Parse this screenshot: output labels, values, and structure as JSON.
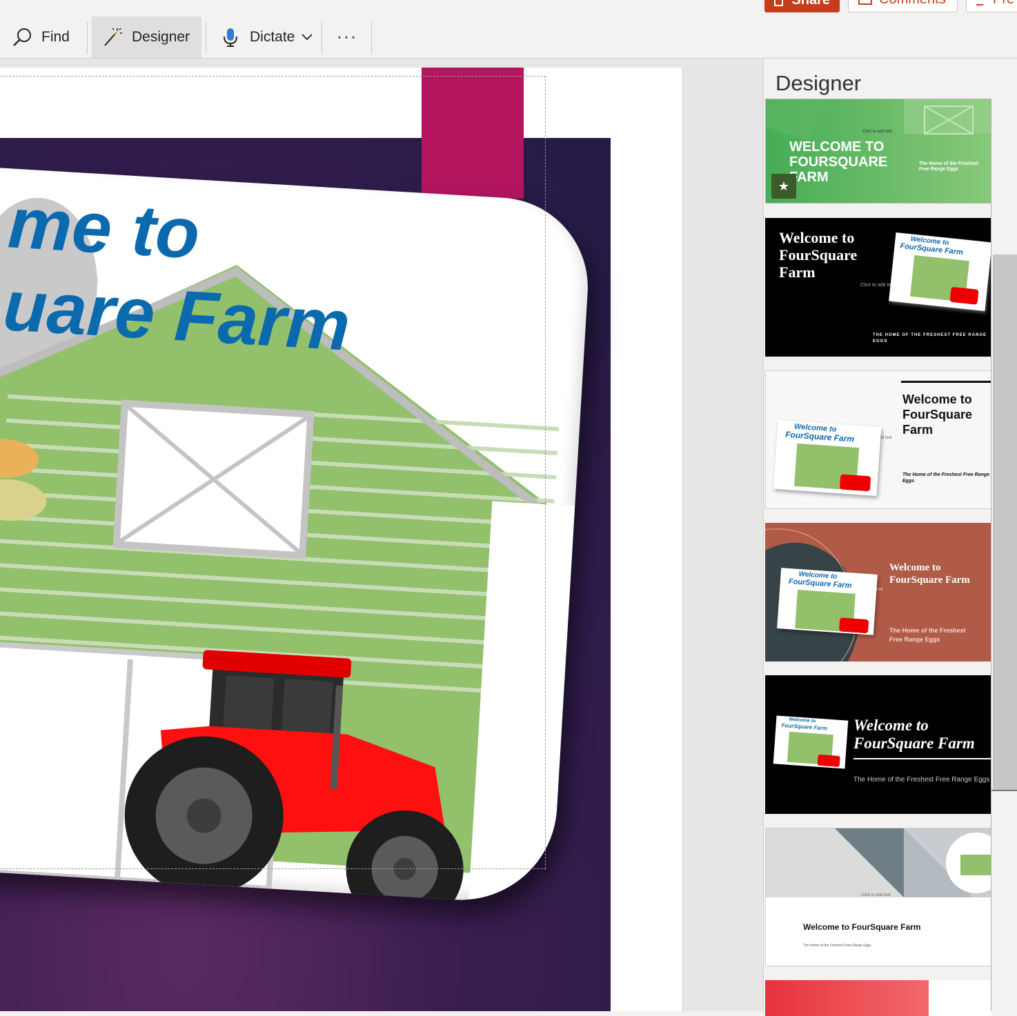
{
  "topbar": {
    "share_label": "Share",
    "comments_label": "Comments",
    "present_label": "Pre"
  },
  "ribbon": {
    "find_label": "Find",
    "designer_label": "Designer",
    "dictate_label": "Dictate",
    "more_label": "···"
  },
  "slide": {
    "title_line1": "me to",
    "title_line2": "uare Farm",
    "colors": {
      "purple": "#3b1e52",
      "magenta": "#b3155f",
      "title_blue": "#0b6aae"
    }
  },
  "designer_pane": {
    "title": "Designer",
    "designs": [
      {
        "title": "WELCOME TO FOURSQUARE FARM",
        "subtitle": "The Home of the Freshest Free Range Eggs",
        "placeholder": "Click to add text"
      },
      {
        "title": "Welcome to FourSquare Farm",
        "subtitle": "THE HOME OF THE FRESHEST FREE RANGE EGGS",
        "placeholder": "Click to add text"
      },
      {
        "title": "Welcome to FourSquare Farm",
        "subtitle": "The Home of the Freshest Free Range Eggs",
        "placeholder": "Click to add text"
      },
      {
        "title": "Welcome to FourSquare Farm",
        "subtitle": "The Home of the Freshest Free Range Eggs",
        "placeholder": "Click to add text"
      },
      {
        "title": "Welcome to FourSquare Farm",
        "subtitle": "The Home of the Freshest Free Range Eggs"
      },
      {
        "title": "Welcome to FourSquare Farm",
        "subtitle": "The Home of the Freshest Free Range Eggs",
        "placeholder": "Click to add text"
      }
    ],
    "thumb_image_title_line1": "Welcome to",
    "thumb_image_title_line2": "FourSquare Farm"
  }
}
